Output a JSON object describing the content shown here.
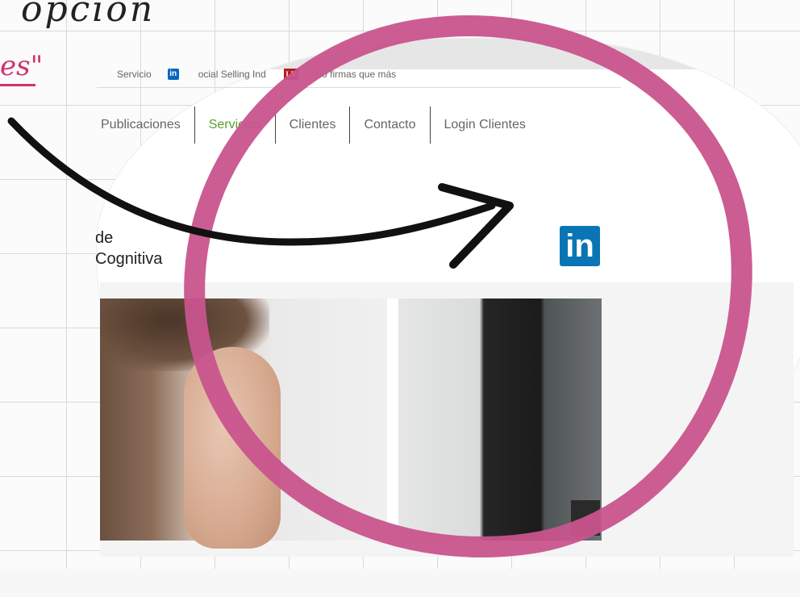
{
  "annotation": {
    "top_text": "opción",
    "link_text": "es\"",
    "circle_color": "#c8548d",
    "link_color": "#d1336f",
    "arrow_color": "#111111"
  },
  "utility_bar": {
    "items": [
      {
        "icon": "none",
        "label": "Servicio"
      },
      {
        "icon": "linkedin-icon",
        "icon_text": "in",
        "label": "ocial Selling Ind"
      },
      {
        "icon": "lr-logo-icon",
        "icon_text": "LR",
        "label": "1.000 firmas que más"
      }
    ]
  },
  "nav": {
    "items": [
      {
        "label": "Publicaciones",
        "active": false
      },
      {
        "label": "Servicios",
        "active": true
      },
      {
        "label": "Clientes",
        "active": false
      },
      {
        "label": "Contacto",
        "active": false
      },
      {
        "label": "Login Clientes",
        "active": false
      }
    ],
    "active_color": "#5aa02c"
  },
  "brand": {
    "line1": "de",
    "line2": "Cognitiva"
  },
  "linkedin_logo": {
    "text": "in",
    "color": "#0a75b4"
  }
}
